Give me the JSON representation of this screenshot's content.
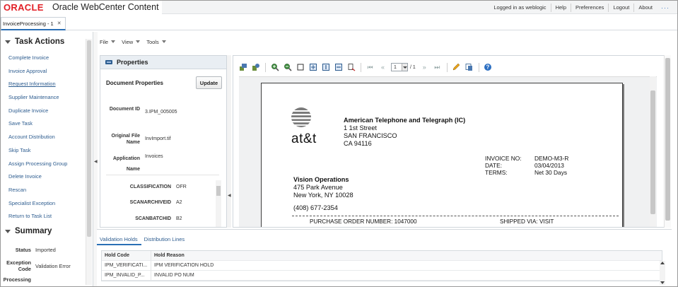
{
  "app": {
    "product_name": "Oracle WebCenter Content"
  },
  "header": {
    "user_status": "Logged in as weblogic",
    "links": [
      "Help",
      "Preferences",
      "Logout",
      "About"
    ]
  },
  "tab": {
    "label": "InvoiceProcessing - 1"
  },
  "task_actions": {
    "title": "Task Actions",
    "items": [
      "Complete Invoice",
      "Invoice Approval",
      "Request Information",
      "Supplier Maintenance",
      "Duplicate Invoice",
      "Save Task",
      "Account Distribution",
      "Skip Task",
      "Assign Processing Group",
      "Delete Invoice",
      "Rescan",
      "Specialist Exception",
      "Return to Task List"
    ]
  },
  "summary": {
    "title": "Summary",
    "status_label": "Status",
    "status_value": "Imported",
    "exception_label": "Exception Code",
    "exception_value": "Validation Error",
    "processing_label": "Processing"
  },
  "menu": {
    "file": "File",
    "view": "View",
    "tools": "Tools"
  },
  "properties": {
    "panel_title": "Properties",
    "section_title": "Document Properties",
    "update_label": "Update",
    "document_id_label": "Document ID",
    "document_id_value": "3.IPM_005005",
    "original_file_label": "Original File Name",
    "original_file_value": "InvImport.tif",
    "application_label": "Application Name",
    "application_value": "Invoices",
    "classification_label": "CLASSIFICATION",
    "classification_value": "OFR",
    "scanarchiveid_label": "SCANARCHIVEID",
    "scanarchiveid_value": "A2",
    "scanbatchid_label": "SCANBATCHID",
    "scanbatchid_value": "B2"
  },
  "viewer": {
    "page_current": "1",
    "page_total": "/ 1"
  },
  "invoice": {
    "company_name": "American Telephone and Telegraph (IC)",
    "company_street": "1 1st Street",
    "company_city": "SAN FRANCISCO",
    "company_state_zip": "CA 94116",
    "logo_text": "at&t",
    "invoice_no_label": "INVOICE NO:",
    "invoice_no_value": "DEMO-M3-R",
    "date_label": "DATE:",
    "date_value": "03/04/2013",
    "terms_label": "TERMS:",
    "terms_value": "Net 30 Days",
    "bill_to_name": "Vision Operations",
    "bill_to_street": "475 Park Avenue",
    "bill_to_city": "New York, NY 10028",
    "phone": "(408) 677-2354",
    "po_number": "PURCHASE ORDER NUMBER: 1047000",
    "shipped_via": "SHIPPED VIA: VISIT"
  },
  "bottom_tabs": {
    "validation_holds": "Validation Holds",
    "distribution_lines": "Distribution Lines"
  },
  "holds_table": {
    "columns": [
      "Hold Code",
      "Hold Reason"
    ],
    "rows": [
      [
        "IPM_VERIFICATI...",
        "IPM VERIFICATION HOLD"
      ],
      [
        "IPM_INVALID_P...",
        "INVALID PO NUM"
      ]
    ]
  },
  "colors": {
    "brand": "#e21f26",
    "link": "#2d5c8f",
    "accent": "#2a6fb5"
  }
}
